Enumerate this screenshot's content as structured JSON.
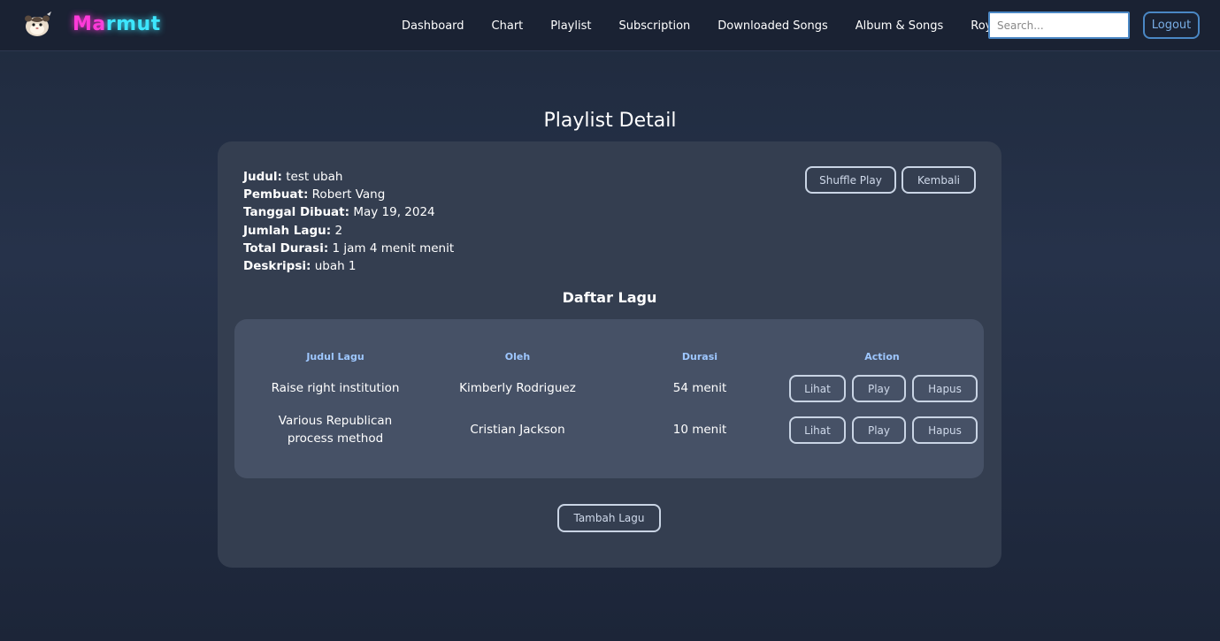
{
  "brand": {
    "part1": "Ma",
    "part2": "rmut"
  },
  "nav": {
    "links": [
      "Dashboard",
      "Chart",
      "Playlist",
      "Subscription",
      "Downloaded Songs",
      "Album & Songs",
      "Royalty"
    ],
    "search_placeholder": "Search...",
    "logout_label": "Logout"
  },
  "page": {
    "title": "Playlist Detail"
  },
  "playlist": {
    "judul_label": "Judul:",
    "judul": "test ubah",
    "pembuat_label": "Pembuat:",
    "pembuat": "Robert Vang",
    "tanggal_label": "Tanggal Dibuat:",
    "tanggal": "May 19, 2024",
    "jumlah_label": "Jumlah Lagu:",
    "jumlah": "2",
    "durasi_label": "Total Durasi:",
    "durasi": "1 jam 4 menit menit",
    "deskripsi_label": "Deskripsi:",
    "deskripsi": "ubah 1"
  },
  "actions": {
    "shuffle_label": "Shuffle Play",
    "back_label": "Kembali",
    "add_label": "Tambah Lagu"
  },
  "songs": {
    "title": "Daftar Lagu",
    "headers": [
      "Judul Lagu",
      "Oleh",
      "Durasi",
      "Action"
    ],
    "rows": [
      {
        "judul": "Raise right institution",
        "oleh": "Kimberly Rodriguez",
        "durasi": "54 menit"
      },
      {
        "judul": "Various Republican process method",
        "oleh": "Cristian Jackson",
        "durasi": "10 menit"
      }
    ],
    "btn_lihat": "Lihat",
    "btn_play": "Play",
    "btn_hapus": "Hapus"
  }
}
